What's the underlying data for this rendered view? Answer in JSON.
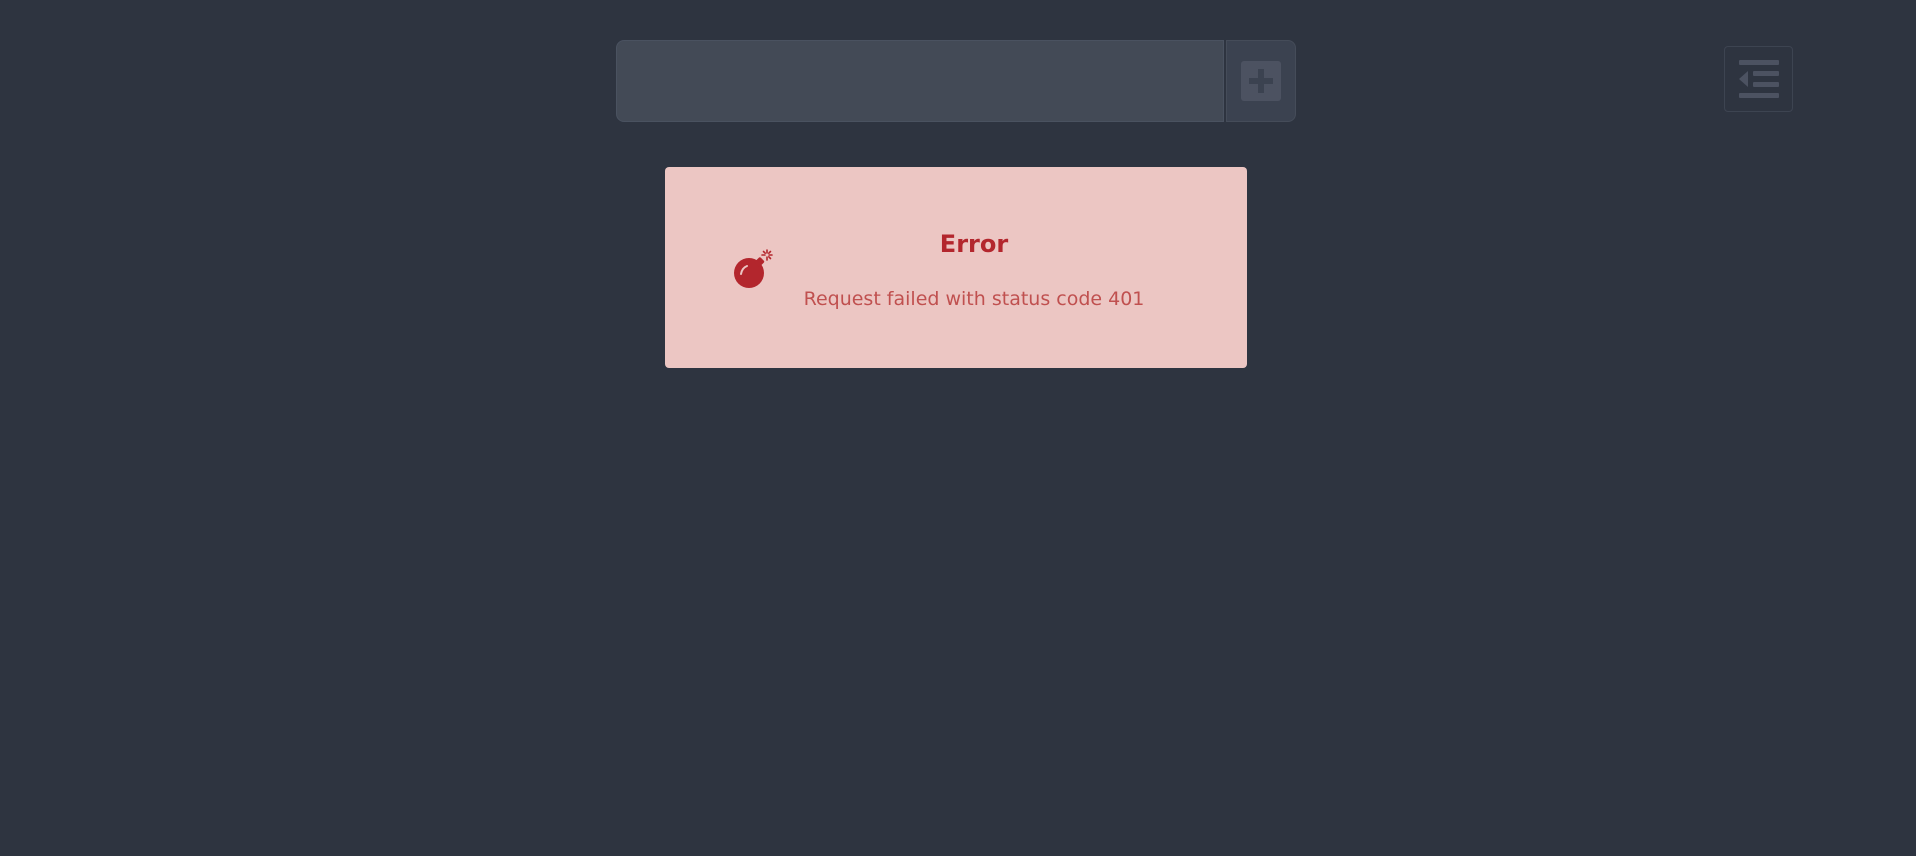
{
  "header": {
    "search": {
      "value": "",
      "placeholder": ""
    },
    "add_button": {
      "icon": "plus-square-icon"
    },
    "sidebar_toggle": {
      "icon": "outdent-icon"
    }
  },
  "error": {
    "icon": "bomb-icon",
    "title": "Error",
    "message": "Request failed with status code 401"
  },
  "colors": {
    "background": "#2e3440",
    "input_background": "#434a56",
    "error_background": "#ecc6c3",
    "error_title": "#b3262d",
    "error_text": "#c0504f",
    "icon_muted": "#4c5261"
  }
}
